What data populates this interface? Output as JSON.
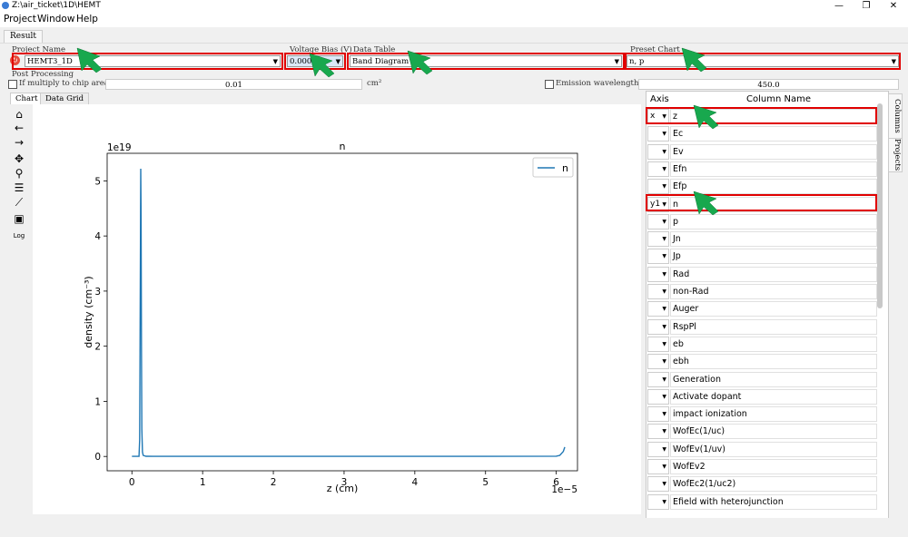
{
  "window": {
    "title": "Z:\\air_ticket\\1D\\HEMT",
    "min": "—",
    "max": "❐",
    "close": "✕"
  },
  "menu": [
    "Project",
    "Window",
    "Help"
  ],
  "tabs": {
    "result": "Result",
    "chart": "Chart",
    "grid": "Data Grid"
  },
  "fields": {
    "project_name_label": "Project Name",
    "project_name_value": "HEMT3_1D",
    "voltage_label": "Voltage Bias (V)",
    "voltage_value": "0.000",
    "datatable_label": "Data Table",
    "datatable_value": "Band Diagram",
    "preset_label": "Preset Chart",
    "preset_value": "n, p",
    "post_label": "Post Processing",
    "multiply_label": "If multiply to chip area A",
    "multiply_value": "0.01",
    "multiply_unit": "cm²",
    "emission_label": "Emission wavelength (nm)",
    "emission_value": "450.0"
  },
  "toolbar": {
    "log": "Log"
  },
  "panel": {
    "axis_header": "Axis",
    "col_header": "Column Name",
    "rows": [
      {
        "axis": "x",
        "name": "z"
      },
      {
        "axis": "",
        "name": "Ec"
      },
      {
        "axis": "",
        "name": "Ev"
      },
      {
        "axis": "",
        "name": "Efn"
      },
      {
        "axis": "",
        "name": "Efp"
      },
      {
        "axis": "y1",
        "name": "n"
      },
      {
        "axis": "",
        "name": "p"
      },
      {
        "axis": "",
        "name": "Jn"
      },
      {
        "axis": "",
        "name": "Jp"
      },
      {
        "axis": "",
        "name": "Rad"
      },
      {
        "axis": "",
        "name": "non-Rad"
      },
      {
        "axis": "",
        "name": "Auger"
      },
      {
        "axis": "",
        "name": "RspPl"
      },
      {
        "axis": "",
        "name": "eb"
      },
      {
        "axis": "",
        "name": "ebh"
      },
      {
        "axis": "",
        "name": "Generation"
      },
      {
        "axis": "",
        "name": "Activate dopant"
      },
      {
        "axis": "",
        "name": "impact ionization"
      },
      {
        "axis": "",
        "name": "WofEc(1/uc)"
      },
      {
        "axis": "",
        "name": "WofEv(1/uv)"
      },
      {
        "axis": "",
        "name": "WofEv2"
      },
      {
        "axis": "",
        "name": "WofEc2(1/uc2)"
      },
      {
        "axis": "",
        "name": "Efield with heterojunction"
      }
    ]
  },
  "side_tabs": {
    "columns": "Columns",
    "projects": "Projects"
  },
  "chart_data": {
    "type": "line",
    "title": "n",
    "xlabel": "z (cm)",
    "ylabel": "density (cm⁻³)",
    "x_multiplier": "1e−5",
    "y_multiplier": "1e19",
    "xlim": [
      -0.35,
      6.3
    ],
    "ylim": [
      -0.26,
      5.5
    ],
    "xticks": [
      0,
      1,
      2,
      3,
      4,
      5,
      6
    ],
    "yticks": [
      0,
      1,
      2,
      3,
      4,
      5
    ],
    "legend": "top-right",
    "grid": false,
    "series": [
      {
        "name": "n",
        "color": "#1f77b4",
        "x": [
          0,
          0.1,
          0.11,
          0.12,
          0.125,
          0.13,
          0.135,
          0.14,
          0.15,
          0.16,
          0.2,
          0.3,
          1,
          2,
          3,
          4,
          5,
          6,
          6.05,
          6.1,
          6.12
        ],
        "y": [
          0.001,
          0.002,
          0.3,
          3.5,
          5.22,
          4.3,
          2.0,
          0.5,
          0.08,
          0.02,
          0.004,
          0.002,
          0.001,
          0.001,
          0.001,
          0.001,
          0.001,
          0.005,
          0.02,
          0.09,
          0.17
        ]
      }
    ]
  }
}
